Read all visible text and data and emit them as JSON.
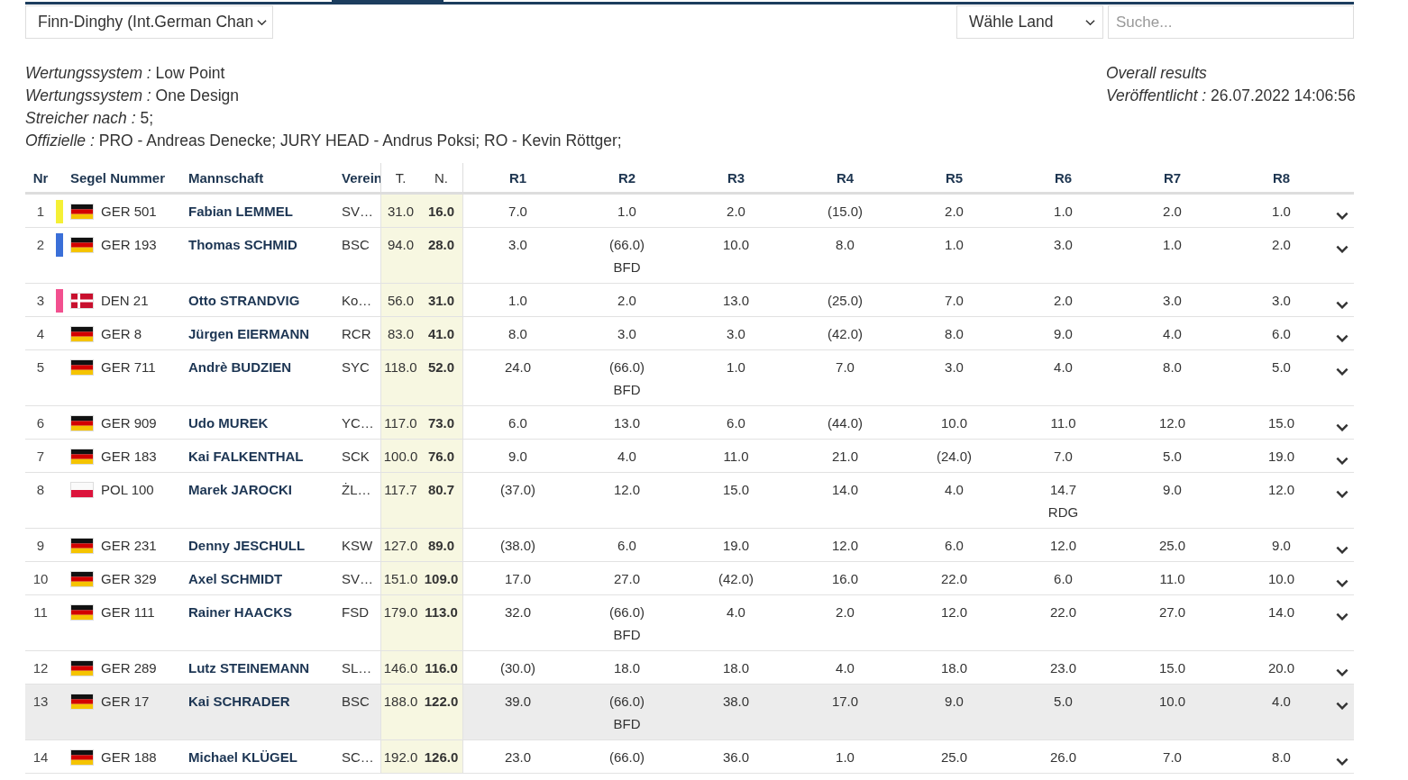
{
  "class_select": {
    "value": "Finn-Dinghy (Int.German Chan"
  },
  "country_select": {
    "value": "Wähle Land"
  },
  "search": {
    "placeholder": "Suche..."
  },
  "info": [
    {
      "label": "Wertungssystem :",
      "value": "Low Point"
    },
    {
      "label": "Wertungssystem :",
      "value": "One Design"
    },
    {
      "label": "Streicher nach :",
      "value": "5;"
    },
    {
      "label": "Offizielle :",
      "value": "PRO - Andreas Denecke; JURY HEAD - Andrus Poksi; RO - Kevin Röttger;"
    }
  ],
  "summary": {
    "title": "Overall results",
    "published_label": "Veröffentlicht :",
    "published_value": "26.07.2022 14:06:56"
  },
  "table": {
    "columns": [
      "Nr",
      "Segel Nummer",
      "Mannschaft",
      "Verein",
      "T.",
      "N.",
      "R1",
      "R2",
      "R3",
      "R4",
      "R5",
      "R6",
      "R7",
      "R8"
    ],
    "rows": [
      {
        "nr": "1",
        "color": "#f5f035",
        "kind": "de",
        "sail": "GER 501",
        "name": "Fabian LEMMEL",
        "club": "SV…",
        "total": "31.0",
        "net": "16.0",
        "highlighted": false,
        "races": [
          "7.0",
          "1.0",
          "2.0",
          "(15.0)",
          "2.0",
          "1.0",
          "2.0",
          "1.0"
        ]
      },
      {
        "nr": "2",
        "color": "#3a6fd8",
        "kind": "de",
        "sail": "GER 193",
        "name": "Thomas SCHMID",
        "club": "BSC",
        "total": "94.0",
        "net": "28.0",
        "highlighted": false,
        "races": [
          "3.0",
          {
            "score": "(66.0)",
            "code": "BFD"
          },
          "10.0",
          "8.0",
          "1.0",
          "3.0",
          "1.0",
          "2.0"
        ]
      },
      {
        "nr": "3",
        "color": "#f2508f",
        "kind": "dk",
        "sail": "DEN 21",
        "name": "Otto STRANDVIG",
        "club": "Ko…",
        "total": "56.0",
        "net": "31.0",
        "highlighted": false,
        "races": [
          "1.0",
          "2.0",
          "13.0",
          "(25.0)",
          "7.0",
          "2.0",
          "3.0",
          "3.0"
        ]
      },
      {
        "nr": "4",
        "kind": "de",
        "sail": "GER 8",
        "name": "Jürgen EIERMANN",
        "club": "RCR",
        "total": "83.0",
        "net": "41.0",
        "highlighted": false,
        "races": [
          "8.0",
          "3.0",
          "3.0",
          "(42.0)",
          "8.0",
          "9.0",
          "4.0",
          "6.0"
        ]
      },
      {
        "nr": "5",
        "kind": "de",
        "sail": "GER 711",
        "name": "Andrè BUDZIEN",
        "club": "SYC",
        "total": "118.0",
        "net": "52.0",
        "highlighted": false,
        "races": [
          "24.0",
          {
            "score": "(66.0)",
            "code": "BFD"
          },
          "1.0",
          "7.0",
          "3.0",
          "4.0",
          "8.0",
          "5.0"
        ]
      },
      {
        "nr": "6",
        "kind": "de",
        "sail": "GER 909",
        "name": "Udo MUREK",
        "club": "YC…",
        "total": "117.0",
        "net": "73.0",
        "highlighted": false,
        "races": [
          "6.0",
          "13.0",
          "6.0",
          "(44.0)",
          "10.0",
          "11.0",
          "12.0",
          "15.0"
        ]
      },
      {
        "nr": "7",
        "kind": "de",
        "sail": "GER 183",
        "name": "Kai FALKENTHAL",
        "club": "SCK",
        "total": "100.0",
        "net": "76.0",
        "highlighted": false,
        "races": [
          "9.0",
          "4.0",
          "11.0",
          "21.0",
          "(24.0)",
          "7.0",
          "5.0",
          "19.0"
        ]
      },
      {
        "nr": "8",
        "kind": "pl",
        "sail": "POL 100",
        "name": "Marek JAROCKI",
        "club": "ŻL…",
        "total": "117.7",
        "net": "80.7",
        "highlighted": false,
        "races": [
          "(37.0)",
          "12.0",
          "15.0",
          "14.0",
          "4.0",
          {
            "score": "14.7",
            "code": "RDG"
          },
          "9.0",
          "12.0"
        ]
      },
      {
        "nr": "9",
        "kind": "de",
        "sail": "GER 231",
        "name": "Denny JESCHULL",
        "club": "KSW",
        "total": "127.0",
        "net": "89.0",
        "highlighted": false,
        "races": [
          "(38.0)",
          "6.0",
          "19.0",
          "12.0",
          "6.0",
          "12.0",
          "25.0",
          "9.0"
        ]
      },
      {
        "nr": "10",
        "kind": "de",
        "sail": "GER 329",
        "name": "Axel SCHMIDT",
        "club": "SV…",
        "total": "151.0",
        "net": "109.0",
        "highlighted": false,
        "races": [
          "17.0",
          "27.0",
          "(42.0)",
          "16.0",
          "22.0",
          "6.0",
          "11.0",
          "10.0"
        ]
      },
      {
        "nr": "11",
        "kind": "de",
        "sail": "GER 111",
        "name": "Rainer HAACKS",
        "club": "FSD",
        "total": "179.0",
        "net": "113.0",
        "highlighted": false,
        "races": [
          "32.0",
          {
            "score": "(66.0)",
            "code": "BFD"
          },
          "4.0",
          "2.0",
          "12.0",
          "22.0",
          "27.0",
          "14.0"
        ]
      },
      {
        "nr": "12",
        "kind": "de",
        "sail": "GER 289",
        "name": "Lutz STEINEMANN",
        "club": "SL…",
        "total": "146.0",
        "net": "116.0",
        "highlighted": false,
        "races": [
          "(30.0)",
          "18.0",
          "18.0",
          "4.0",
          "18.0",
          "23.0",
          "15.0",
          "20.0"
        ]
      },
      {
        "nr": "13",
        "kind": "de",
        "sail": "GER 17",
        "name": "Kai SCHRADER",
        "club": "BSC",
        "total": "188.0",
        "net": "122.0",
        "highlighted": true,
        "races": [
          "39.0",
          {
            "score": "(66.0)",
            "code": "BFD"
          },
          "38.0",
          "17.0",
          "9.0",
          "5.0",
          "10.0",
          "4.0"
        ]
      },
      {
        "nr": "14",
        "kind": "de",
        "sail": "GER 188",
        "name": "Michael KLÜGEL",
        "club": "SC…",
        "total": "192.0",
        "net": "126.0",
        "highlighted": false,
        "races": [
          "23.0",
          "(66.0)",
          "36.0",
          "1.0",
          "25.0",
          "26.0",
          "7.0",
          "8.0"
        ]
      }
    ]
  }
}
